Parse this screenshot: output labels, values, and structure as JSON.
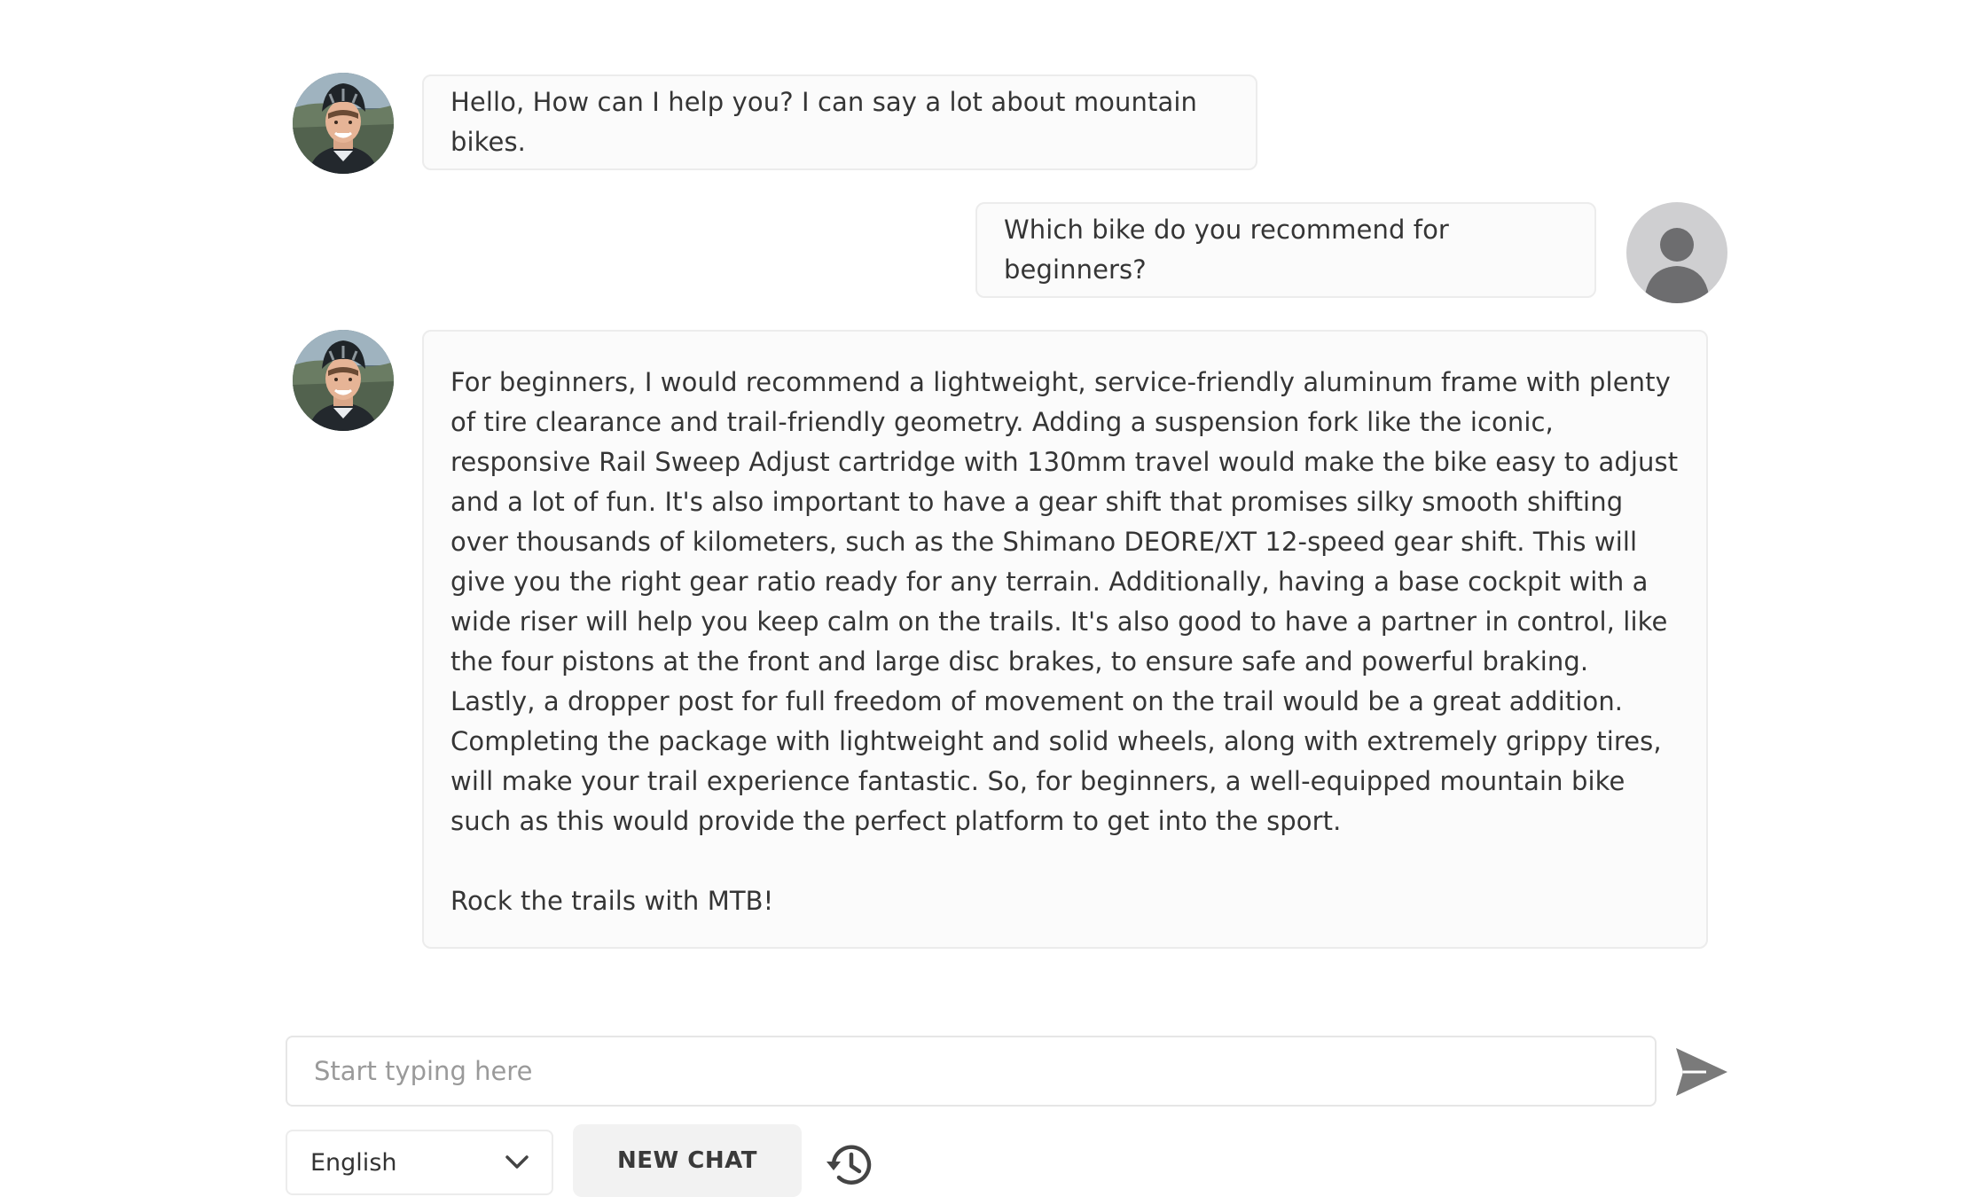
{
  "messages": [
    {
      "role": "bot",
      "text": "Hello, How can I help you? I can say a lot about mountain bikes."
    },
    {
      "role": "user",
      "text": "Which bike do you recommend for beginners?"
    },
    {
      "role": "bot",
      "paragraphs": [
        "For beginners, I would recommend a lightweight, service-friendly aluminum frame with plenty of tire clearance and trail-friendly geometry. Adding a suspension fork like the iconic, responsive Rail Sweep Adjust cartridge with 130mm travel would make the bike easy to adjust and a lot of fun. It's also important to have a gear shift that promises silky smooth shifting over thousands of kilometers, such as the Shimano DEORE/XT 12-speed gear shift. This will give you the right gear ratio ready for any terrain. Additionally, having a base cockpit with a wide riser will help you keep calm on the trails. It's also good to have a partner in control, like the four pistons at the front and large disc brakes, to ensure safe and powerful braking. Lastly, a dropper post for full freedom of movement on the trail would be a great addition. Completing the package with lightweight and solid wheels, along with extremely grippy tires, will make your trail experience fantastic. So, for beginners, a well-equipped mountain bike such as this would provide the perfect platform to get into the sport.",
        "Rock the trails with MTB!"
      ]
    }
  ],
  "composer": {
    "placeholder": "Start typing here",
    "value": ""
  },
  "controls": {
    "language": "English",
    "new_chat_label": "NEW CHAT"
  },
  "icons": {
    "send": "send-icon",
    "history": "history-icon",
    "dropdown": "chevron-down-icon",
    "user_avatar": "user-silhouette-icon"
  },
  "colors": {
    "bubble_bg": "#fbfbfb",
    "bubble_border": "#ececec",
    "icon_gray": "#7a7a7a",
    "user_avatar_bg": "#cfcfd1",
    "user_avatar_fg": "#6d6d6f",
    "button_bg": "#f2f2f2"
  }
}
